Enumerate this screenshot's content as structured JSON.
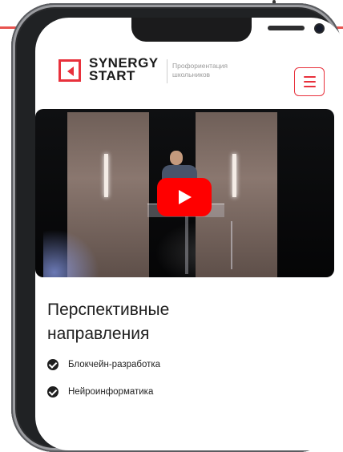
{
  "brand": {
    "name_line1": "SYNERGY",
    "name_line2": "START",
    "tagline_line1": "Профориентация",
    "tagline_line2": "школьников",
    "accent_color": "#e8313c"
  },
  "header": {
    "menu_icon": "hamburger-icon"
  },
  "video": {
    "play_icon": "play-icon",
    "play_color": "#ff0000"
  },
  "section": {
    "title_line1": "Перспективные",
    "title_line2": "направления",
    "items": [
      "Блокчейн-разработка",
      "Нейроинформатика"
    ],
    "item_icon": "check-circle-icon"
  }
}
